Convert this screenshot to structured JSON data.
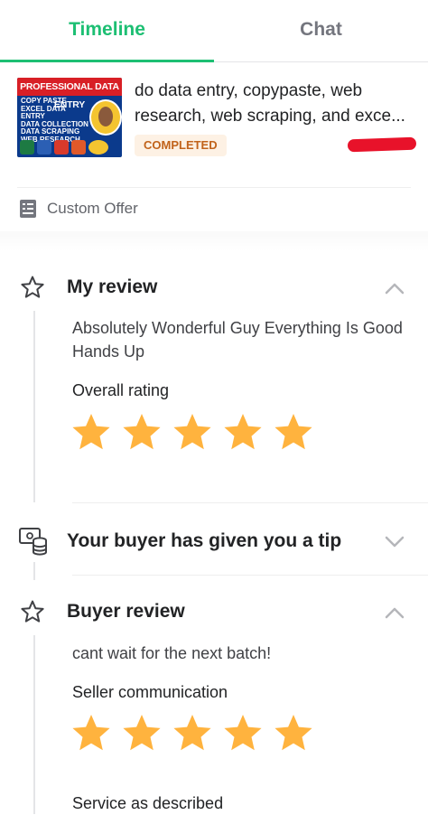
{
  "tabs": {
    "timeline": "Timeline",
    "chat": "Chat"
  },
  "order": {
    "thumbnail": {
      "banner": "PROFESSIONAL DATA ENTRY",
      "lines": [
        "COPY PASTE",
        "EXCEL DATA ENTRY",
        "DATA COLLECTION",
        "DATA SCRAPING",
        "WEB RESEARCH"
      ]
    },
    "title": "do data entry, copypaste, web research, web scraping, and exce...",
    "status": "COMPLETED",
    "offer_label": "Custom Offer"
  },
  "my_review": {
    "title": "My review",
    "text": "Absolutely Wonderful Guy Everything Is Good Hands Up",
    "rating_label": "Overall rating",
    "rating": 5
  },
  "tip": {
    "title": "Your buyer has given you a tip"
  },
  "buyer_review": {
    "title": "Buyer review",
    "text": "cant wait for the next batch!",
    "communication_label": "Seller communication",
    "communication_rating": 5,
    "service_label": "Service as described"
  },
  "colors": {
    "accent": "#1dbf73",
    "star": "#ffb33e",
    "badge_bg": "#fdf1e4",
    "badge_text": "#c1631b"
  }
}
